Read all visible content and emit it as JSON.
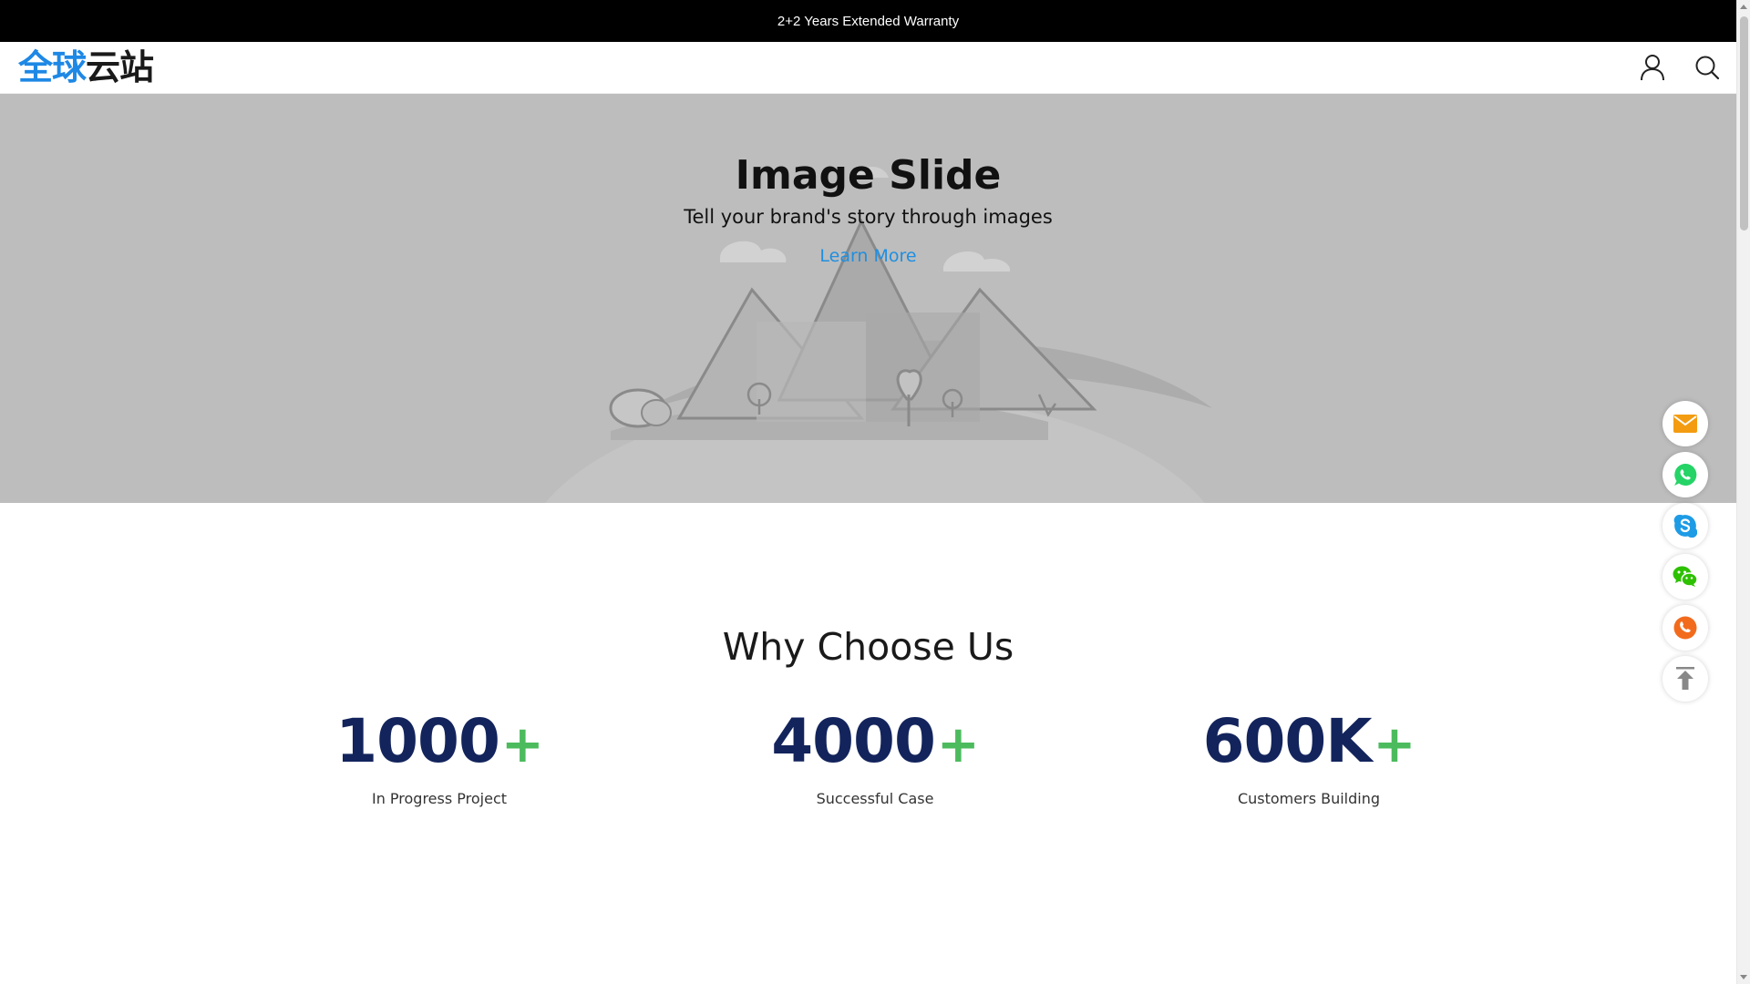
{
  "announcement": {
    "text": "2+2 Years Extended Warranty"
  },
  "header": {
    "logo_part1": "全球",
    "logo_part2": "云站",
    "icons": [
      "user-icon",
      "search-icon"
    ]
  },
  "hero": {
    "title": "Image Slide",
    "subtitle": "Tell your brand's story through images",
    "link_label": "Learn More",
    "background_color": "#bdbdbd",
    "link_color": "#1f8fe0"
  },
  "why": {
    "title": "Why Choose Us",
    "stats": [
      {
        "value": "1000",
        "suffix": "+",
        "label": "In Progress Project"
      },
      {
        "value": "4000",
        "suffix": "+",
        "label": "Successful Case"
      },
      {
        "value": "600K",
        "suffix": "+",
        "label": "Customers Building"
      }
    ],
    "number_color": "#13245c",
    "plus_color": "#4cbb5e"
  },
  "floating_contacts": [
    {
      "name": "email-icon",
      "color": "#f39c12"
    },
    {
      "name": "whatsapp-icon",
      "color": "#25d366"
    },
    {
      "name": "skype-icon",
      "color": "#1e9be5"
    },
    {
      "name": "wechat-icon",
      "color": "#2dc100"
    },
    {
      "name": "phone-icon",
      "color": "#f26b1d"
    },
    {
      "name": "back-to-top-icon",
      "color": "#888888"
    }
  ]
}
